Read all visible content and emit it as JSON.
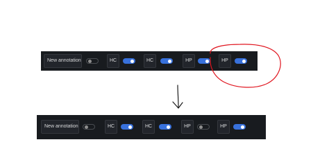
{
  "panels": {
    "before": {
      "annotation_label": "New annotation",
      "annotation_enabled": false,
      "toggles": [
        {
          "label": "HC",
          "on": true
        },
        {
          "label": "HC",
          "on": true
        },
        {
          "label": "HP",
          "on": true
        },
        {
          "label": "HP",
          "on": true
        }
      ]
    },
    "after": {
      "annotation_label": "New annotation",
      "annotation_enabled": false,
      "toggles": [
        {
          "label": "HC",
          "on": true
        },
        {
          "label": "HC",
          "on": true
        },
        {
          "label": "HP",
          "on": false
        },
        {
          "label": "HP",
          "on": true
        }
      ]
    }
  },
  "colors": {
    "toolbar_bg": "#181b1f",
    "toggle_on": "#3871dc",
    "highlight_ring": "#e0141e",
    "arrow_ink": "#1a1a1a"
  },
  "icons": {
    "highlight": "red-circle-highlight",
    "arrow": "hand-drawn-down-arrow-icon"
  }
}
